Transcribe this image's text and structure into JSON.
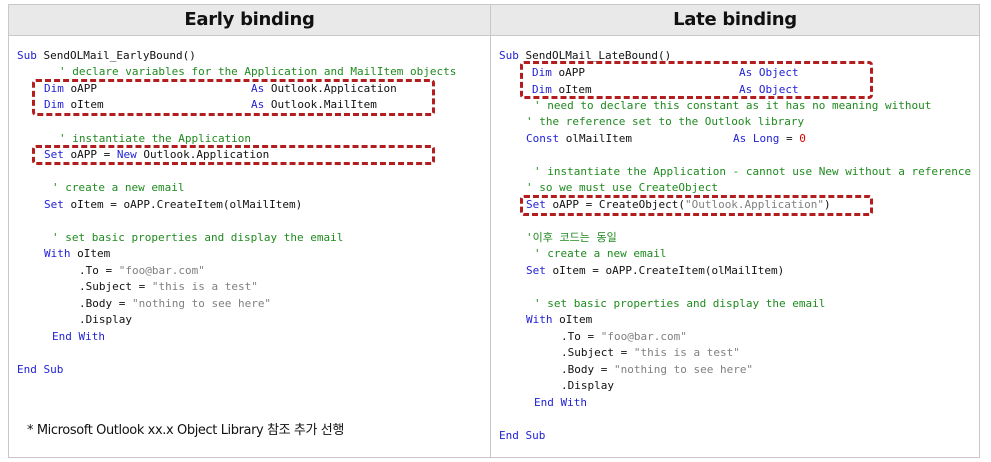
{
  "left": {
    "title": "Early binding",
    "lines": {
      "l01_kw": "Sub",
      "l01_tx": " SendOLMail_EarlyBound()",
      "l02": "' declare variables for the Application and MailItem objects",
      "l03_kw": "Dim",
      "l03_tx": " oAPP",
      "l03_as": "As",
      "l03_type": " Outlook.Application",
      "l04_kw": "Dim",
      "l04_tx": " oItem",
      "l04_as": "As",
      "l04_type": " Outlook.MailItem",
      "l05": "' instantiate the Application",
      "l06_kw": "Set",
      "l06_tx": " oAPP = ",
      "l06_new": "New",
      "l06_tx2": " Outlook.Application",
      "l07": "' create a new email",
      "l08_kw": "Set",
      "l08_tx": " oItem = oAPP.CreateItem(olMailItem)",
      "l09": "' set basic properties and display the email",
      "l10_kw": "With",
      "l10_tx": " oItem",
      "l11_tx": ".To = ",
      "l11_st": "\"foo@bar.com\"",
      "l12_tx": ".Subject = ",
      "l12_st": "\"this is a test\"",
      "l13_tx": ".Body = ",
      "l13_st": "\"nothing to see here\"",
      "l14_tx": ".Display",
      "l15_kw": "End With",
      "l16_kw": "End Sub"
    },
    "note": "* Microsoft Outlook xx.x Object Library 참조 추가 선행"
  },
  "right": {
    "title": "Late binding",
    "lines": {
      "r01_kw": "Sub",
      "r01_tx": " SendOLMail_LateBound()",
      "r02_kw": "Dim",
      "r02_tx": " oAPP",
      "r02_as": "As Object",
      "r03_kw": "Dim",
      "r03_tx": " oItem",
      "r03_as": "As Object",
      "r04": "' need to declare this constant as it has no meaning without",
      "r05": "' the reference set to the Outlook library",
      "r06_kw": "Const",
      "r06_tx": " olMailItem",
      "r06_as": "As Long",
      "r06_eq": " = ",
      "r06_num": "0",
      "r07": "' instantiate the Application - cannot use New without a reference",
      "r08": "' so we must use CreateObject",
      "r09_kw": "Set",
      "r09_tx": " oAPP = CreateObject(",
      "r09_st": "\"Outlook.Application\"",
      "r09_tx2": ")",
      "r10": "'이후 코드는 동일",
      "r11": "' create a new email",
      "r12_kw": "Set",
      "r12_tx": " oItem = oAPP.CreateItem(olMailItem)",
      "r13": "' set basic properties and display the email",
      "r14_kw": "With",
      "r14_tx": " oItem",
      "r15_tx": ".To = ",
      "r15_st": "\"foo@bar.com\"",
      "r16_tx": ".Subject = ",
      "r16_st": "\"this is a test\"",
      "r17_tx": ".Body = ",
      "r17_st": "\"nothing to see here\"",
      "r18_tx": ".Display",
      "r19_kw": "End With",
      "r20_kw": "End Sub"
    }
  }
}
